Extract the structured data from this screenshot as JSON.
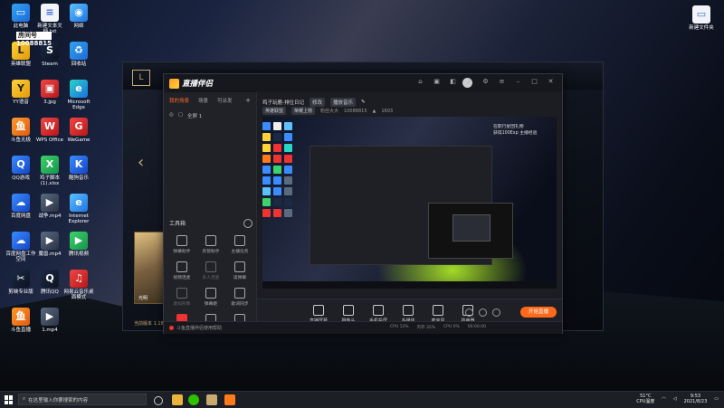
{
  "desktop": {
    "icons": [
      {
        "label": "此电脑",
        "glyph": "▭",
        "color": "ic-win"
      },
      {
        "label": "新建文本文档.txt",
        "glyph": "≡",
        "color": "ic-doc"
      },
      {
        "label": "网络",
        "glyph": "◉",
        "color": "ic-net"
      },
      {
        "label": "英雄联盟",
        "glyph": "L",
        "color": "ic-yellow"
      },
      {
        "label": "Steam",
        "glyph": "S",
        "color": "ic-steam"
      },
      {
        "label": "回收站",
        "glyph": "♻",
        "color": "ic-win"
      },
      {
        "label": "YY语音",
        "glyph": "Y",
        "color": "ic-yellow"
      },
      {
        "label": "3.jpg",
        "glyph": "▣",
        "color": "ic-red"
      },
      {
        "label": "Microsoft Edge",
        "glyph": "e",
        "color": "ic-edge"
      },
      {
        "label": "斗鱼无极",
        "glyph": "鱼",
        "color": "ic-orange"
      },
      {
        "label": "WPS Office",
        "glyph": "W",
        "color": "ic-red"
      },
      {
        "label": "WeGame",
        "glyph": "G",
        "color": "ic-red"
      },
      {
        "label": "QQ游戏",
        "glyph": "Q",
        "color": "ic-blue"
      },
      {
        "label": "鸡子脚本(1).xlsx",
        "glyph": "X",
        "color": "ic-green"
      },
      {
        "label": "酷狗音乐",
        "glyph": "K",
        "color": "ic-blue"
      },
      {
        "label": "百度网盘",
        "glyph": "☁",
        "color": "ic-blue"
      },
      {
        "label": "战争.mp4",
        "glyph": "▶",
        "color": "ic-video"
      },
      {
        "label": "Internet Explorer",
        "glyph": "e",
        "color": "ic-net"
      },
      {
        "label": "百度网盘工作空间",
        "glyph": "☁",
        "color": "ic-blue"
      },
      {
        "label": "魔兽.mp4",
        "glyph": "▶",
        "color": "ic-video"
      },
      {
        "label": "腾讯视频",
        "glyph": "▶",
        "color": "ic-green"
      },
      {
        "label": "剪映专业版",
        "glyph": "✂",
        "color": "ic-steam"
      },
      {
        "label": "腾讯QQ",
        "glyph": "Q",
        "color": "ic-steam"
      },
      {
        "label": "网易云音乐桌面模式",
        "glyph": "♫",
        "color": "ic-red"
      },
      {
        "label": "斗鱼直播",
        "glyph": "鱼",
        "color": "ic-orange"
      },
      {
        "label": "1.mp4",
        "glyph": "▶",
        "color": "ic-video"
      },
      {
        "label": "新建文件夹",
        "glyph": "▭",
        "color": "ic-doc"
      }
    ],
    "room_label": "房间号",
    "room_number": "10088815"
  },
  "lol_window": {
    "art_caption": "光明",
    "bottom_text": "当前版本 1.18"
  },
  "obs": {
    "app_name": "直播伴侣",
    "left_tabs": [
      {
        "label": "我的场景",
        "active": true
      },
      {
        "label": "场景",
        "active": false
      },
      {
        "label": "可派发",
        "active": false
      }
    ],
    "scene_item": "全屏 1",
    "tools_title": "工具箱",
    "tools": [
      {
        "label": "弹幕助手",
        "dim": false,
        "red": false
      },
      {
        "label": "房管助手",
        "dim": false,
        "red": false
      },
      {
        "label": "主播任务",
        "dim": false,
        "red": false
      },
      {
        "label": "视频连麦",
        "dim": false,
        "red": false
      },
      {
        "label": "多人连麦",
        "dim": true,
        "red": false
      },
      {
        "label": "读弹幕",
        "dim": false,
        "red": false
      },
      {
        "label": "虚拟形象",
        "dim": true,
        "red": false
      },
      {
        "label": "弹幕姬",
        "dim": false,
        "red": false
      },
      {
        "label": "歌词同步",
        "dim": false,
        "red": false
      },
      {
        "label": "",
        "dim": false,
        "red": true
      },
      {
        "label": "",
        "dim": false,
        "red": false
      },
      {
        "label": "",
        "dim": false,
        "red": false
      }
    ],
    "stream_title": "鸡子玩鹿-排位日记",
    "title_badge": "修改",
    "category": "播放音乐",
    "tags": [
      {
        "label": "英雄联盟"
      },
      {
        "label": "荣耀上榜"
      }
    ],
    "fans_label": "粉丝大大",
    "room_no": "10088815",
    "hot_value": "1603",
    "preview_lines": [
      "欢迎"
    ],
    "preview_text1": "在职行星团礼物",
    "preview_text2": "获得100Exp 主播经验",
    "bottom_buttons": [
      {
        "label": "直播屏幕"
      },
      {
        "label": "摄像头"
      },
      {
        "label": "手机投屏"
      },
      {
        "label": "多媒体"
      },
      {
        "label": "麦克风"
      },
      {
        "label": "扬声器"
      }
    ],
    "live_button": "开始直播",
    "status_left": "斗鱼直播伴侣使用帮助",
    "stats": [
      {
        "label": "CPU 12%"
      },
      {
        "label": "内存 35%"
      },
      {
        "label": "CPU 0%"
      },
      {
        "label": "00:00:00"
      }
    ]
  },
  "taskbar": {
    "search_placeholder": "在这里输入你要搜索的内容",
    "weather": "51°C",
    "weather_sub": "CPU温度",
    "time": "9:53",
    "date": "2021/8/23"
  }
}
